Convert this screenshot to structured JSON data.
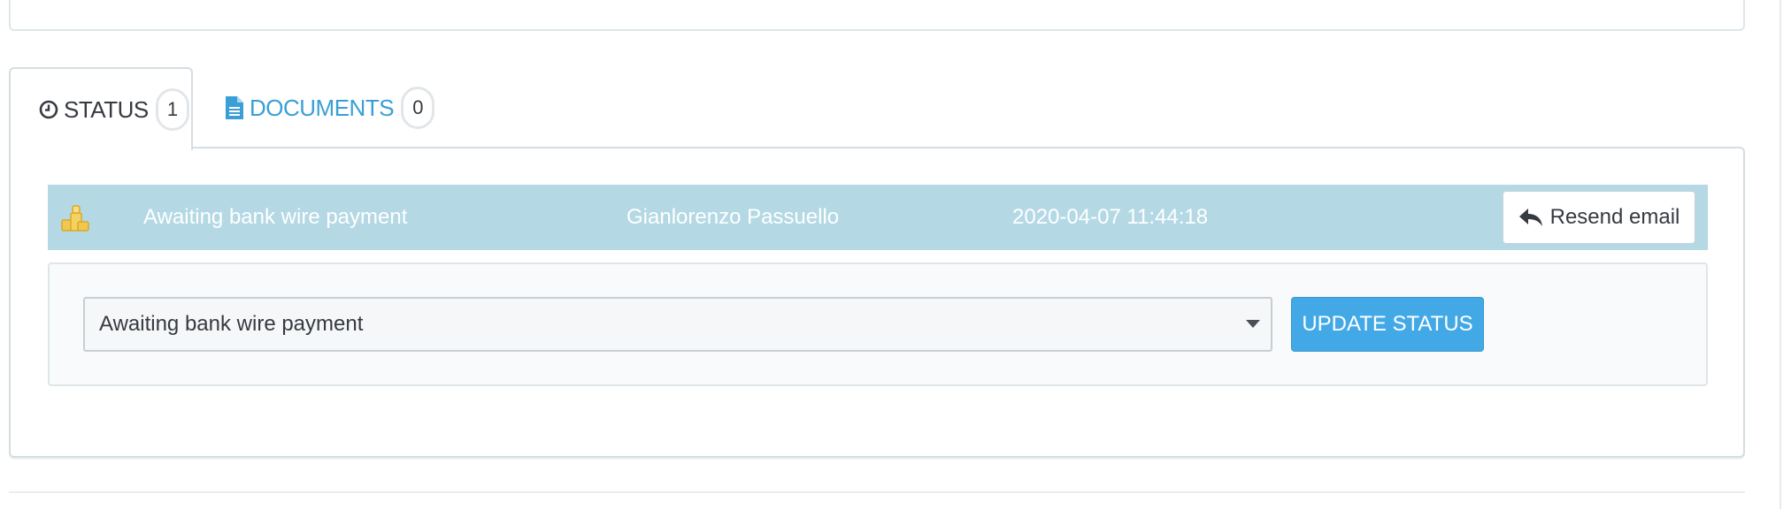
{
  "tabs": [
    {
      "label": "STATUS",
      "count": "1",
      "icon": "clock-icon"
    },
    {
      "label": "DOCUMENTS",
      "count": "0",
      "icon": "document-icon"
    }
  ],
  "history": {
    "status_icon": "coins-icon",
    "status": "Awaiting bank wire payment",
    "employee": "Gianlorenzo Passuello",
    "date": "2020-04-07 11:44:18",
    "resend_label": "Resend email",
    "resend_icon": "reply-arrow-icon"
  },
  "update": {
    "selected_status": "Awaiting bank wire payment",
    "button_label": "UPDATE STATUS"
  },
  "colors": {
    "accent": "#43a9e6",
    "row_bg": "#b4d9e5",
    "tab_link": "#3a9fd6"
  }
}
